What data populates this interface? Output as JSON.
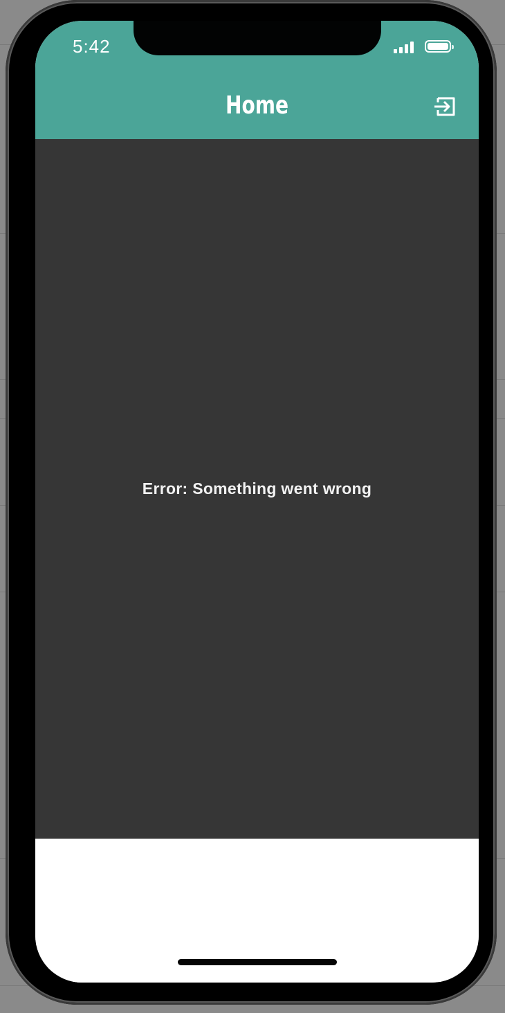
{
  "status_bar": {
    "time": "5:42"
  },
  "header": {
    "title": "Home",
    "logout_icon": "logout-icon"
  },
  "content": {
    "error_message": "Error: Something went wrong"
  },
  "colors": {
    "header_bg": "#4ba598",
    "content_bg": "#363636",
    "text": "#f2f2f2"
  }
}
